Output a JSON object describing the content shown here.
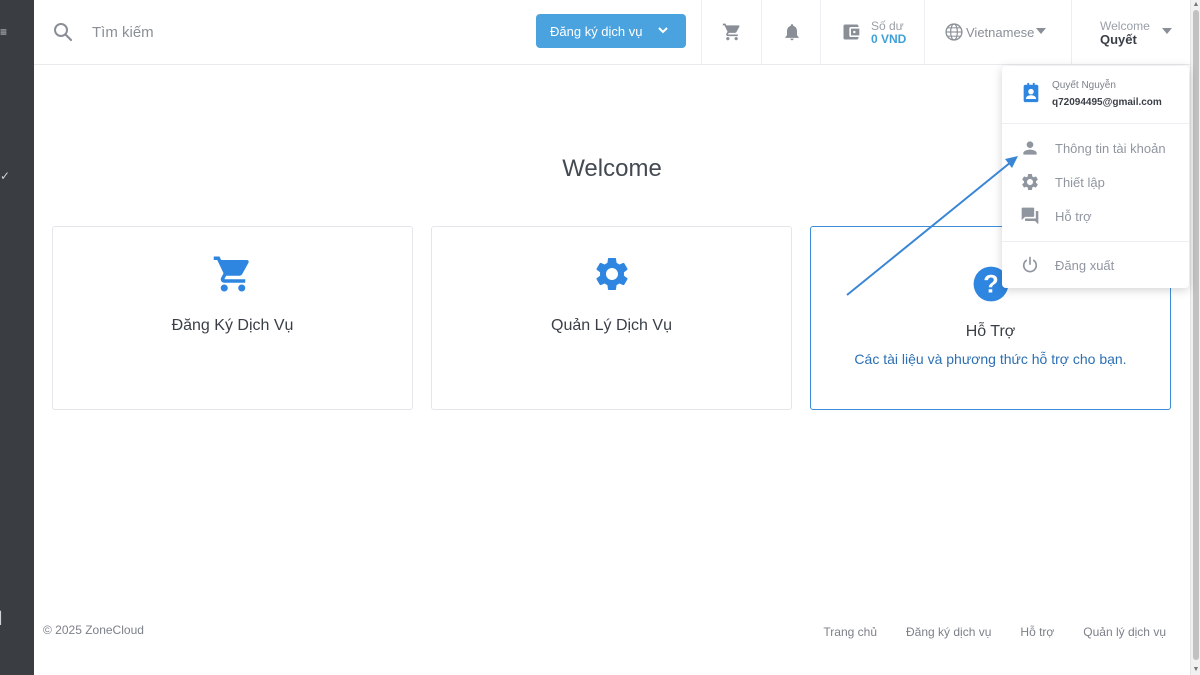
{
  "search": {
    "placeholder": "Tìm kiếm"
  },
  "header": {
    "register_button": "Đăng ký dịch vụ",
    "balance_label": "Số dư",
    "balance_value": "0 VND",
    "language": "Vietnamese",
    "welcome_label": "Welcome",
    "user_first_name": "Quyết"
  },
  "main": {
    "title": "Welcome",
    "cards": [
      {
        "title": "Đăng Ký Dịch Vụ",
        "icon": "cart-icon"
      },
      {
        "title": "Quản Lý Dịch Vụ",
        "icon": "gear-icon"
      },
      {
        "title": "Hỗ Trợ",
        "description": "Các tài liệu và phương thức hỗ trợ cho bạn.",
        "icon": "help-icon"
      }
    ]
  },
  "dropdown": {
    "user_name": "Quyết Nguyễn",
    "email": "q72094495@gmail.com",
    "items": [
      {
        "label": "Thông tin tài khoản",
        "icon": "person-icon"
      },
      {
        "label": "Thiết lập",
        "icon": "gear-icon"
      },
      {
        "label": "Hỗ trợ",
        "icon": "chat-icon"
      },
      {
        "label": "Đăng xuất",
        "icon": "power-icon"
      }
    ]
  },
  "footer": {
    "copyright": "© 2025 ZoneCloud",
    "links": [
      "Trang chủ",
      "Đăng ký dịch vụ",
      "Hỗ trợ",
      "Quản lý dịch vụ"
    ]
  },
  "colors": {
    "accent": "#4aa3df",
    "sidebar": "#3a3d42",
    "link": "#2c6fb3",
    "icon_blue": "#2f86e0",
    "annotation_arrow": "#3a86d6"
  }
}
